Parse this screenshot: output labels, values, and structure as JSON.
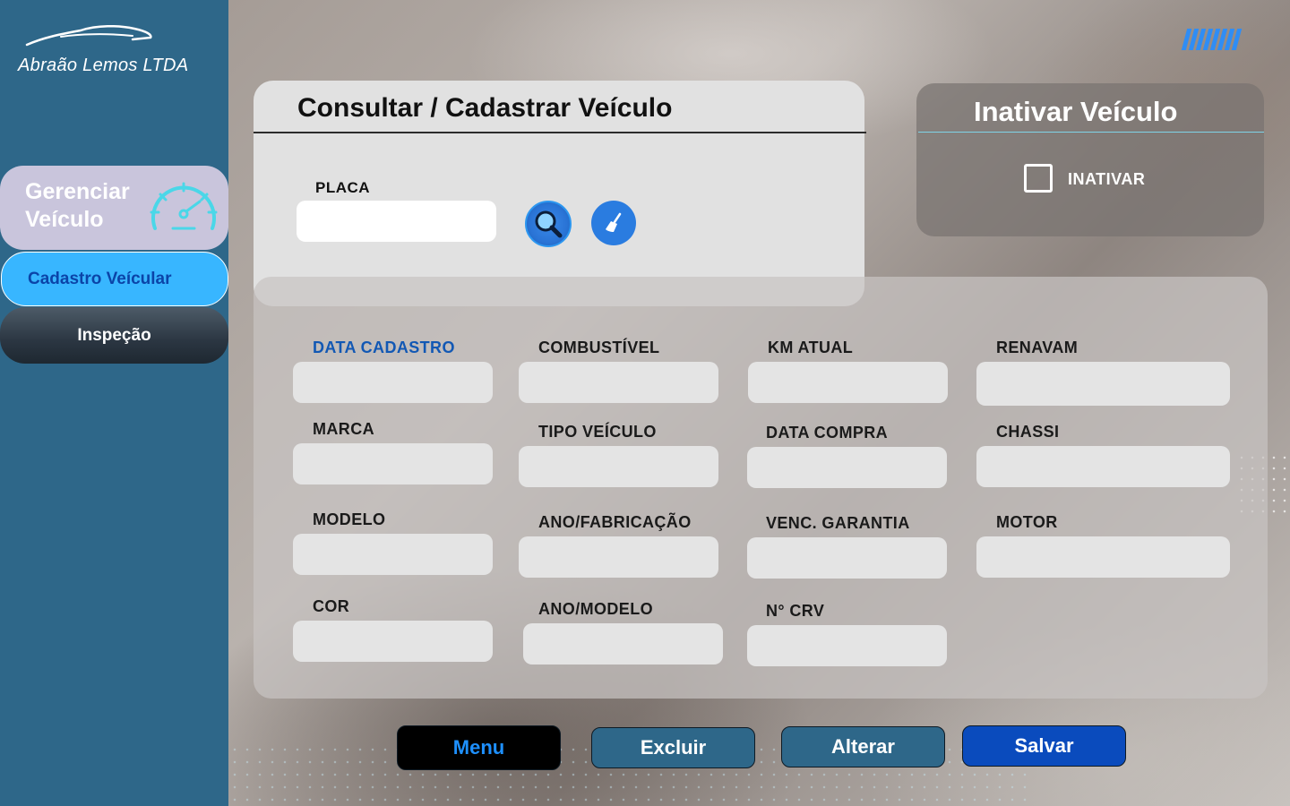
{
  "brand": {
    "name": "Abraão Lemos LTDA"
  },
  "sidebar": {
    "manage_label": "Gerenciar Veículo",
    "items": [
      {
        "label": "Cadastro Veícular",
        "active": true
      },
      {
        "label": "Inspeção",
        "active": false
      }
    ]
  },
  "consult": {
    "title": "Consultar / Cadastrar Veículo",
    "placa_label": "PLACA",
    "placa_value": ""
  },
  "inactivate": {
    "title": "Inativar Veículo",
    "checkbox_label": "INATIVAR",
    "checked": false
  },
  "form": {
    "fields": {
      "data_cadastro": "DATA CADASTRO",
      "combustivel": "COMBUSTÍVEL",
      "km_atual": "KM ATUAL",
      "renavam": "RENAVAM",
      "marca": "MARCA",
      "tipo_veiculo": "TIPO VEÍCULO",
      "data_compra": "DATA COMPRA",
      "chassi": "CHASSI",
      "modelo": "MODELO",
      "ano_fabricacao": "ANO/FABRICAÇÃO",
      "venc_garantia": "VENC. GARANTIA",
      "motor": "MOTOR",
      "cor": "COR",
      "ano_modelo": "ANO/MODELO",
      "n_crv": "N° CRV"
    }
  },
  "actions": {
    "menu": "Menu",
    "excluir": "Excluir",
    "alterar": "Alterar",
    "salvar": "Salvar"
  },
  "icons": {
    "logo": "car-outline-icon",
    "manage": "speedometer-icon",
    "search": "search-icon",
    "clear": "broom-icon",
    "decoration": "stripes-icon"
  },
  "colors": {
    "sidebar": "#2e6789",
    "active_item": "#38b6ff",
    "primary": "#0a4bbd",
    "accent_blue": "#2f8df5"
  }
}
